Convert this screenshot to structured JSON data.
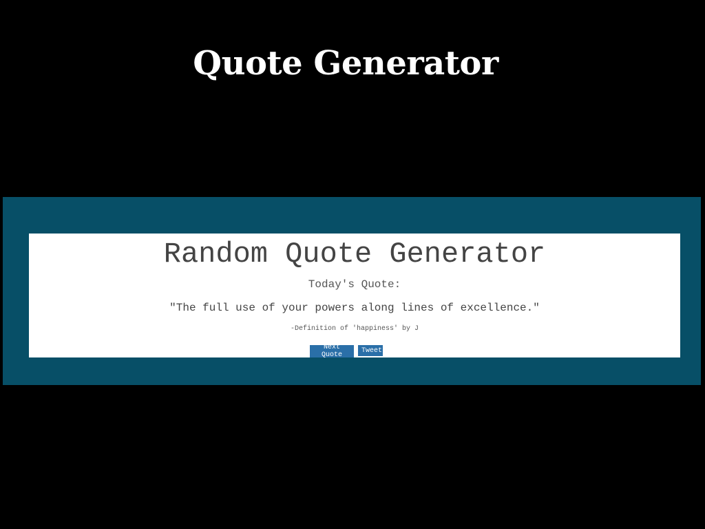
{
  "slide": {
    "title": "Quote Generator"
  },
  "app": {
    "title": "Random Quote Generator",
    "todays_label": "Today's Quote:",
    "quote": "\"The full use of your powers along lines of excellence.\"",
    "author": "-Definition of 'happiness' by J",
    "buttons": {
      "next_label": "Next Quote",
      "tweet_label": "Tweet",
      "tweet_icon": "twitter-bird-icon"
    }
  },
  "colors": {
    "background": "#000000",
    "frame": "#074f67",
    "card": "#ffffff",
    "button": "#2a6fa8"
  }
}
